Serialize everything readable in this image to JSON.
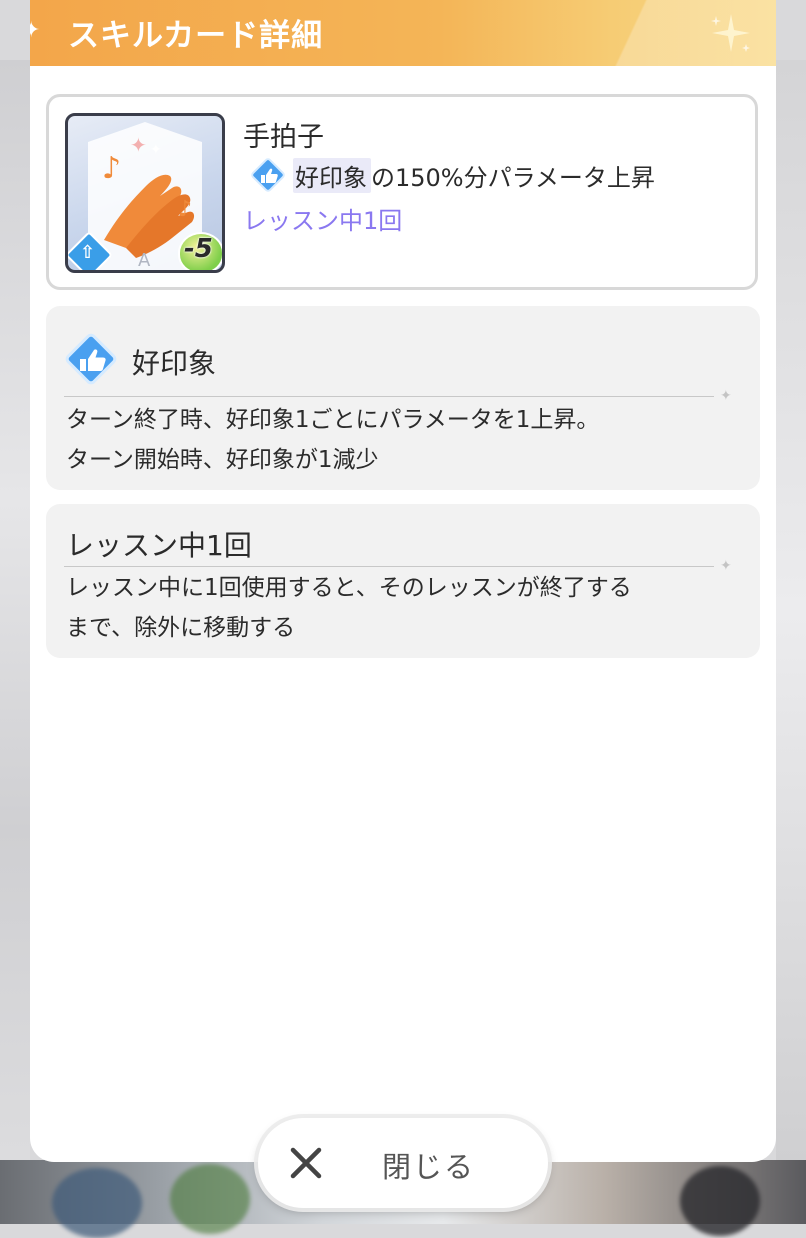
{
  "header": {
    "title": "スキルカード詳細"
  },
  "card": {
    "name": "手拍子",
    "effect_keyword": "好印象",
    "effect_text": "の150%分パラメータ上昇",
    "limit": "レッスン中1回",
    "cost": "-5",
    "rarity_letter": "A",
    "art_icon": "clapping-hands-icon",
    "cost_icon": "heart-icon",
    "plan_icon": "up-arrow-diamond-icon"
  },
  "keywords": [
    {
      "title": "好印象",
      "icon": "thumbs-up-icon",
      "lines": [
        "ターン終了時、好印象1ごとにパラメータを1上昇。",
        "ターン開始時、好印象が1減少"
      ]
    },
    {
      "title": "レッスン中1回",
      "lines": [
        "レッスン中に1回使用すると、そのレッスンが終了する",
        "まで、除外に移動する"
      ]
    }
  ],
  "close_button": {
    "label": "閉じる",
    "icon": "close-icon"
  },
  "colors": {
    "header_start": "#f3a64a",
    "header_end": "#f8d884",
    "limit_text": "#8a78f0",
    "thumb_icon": "#4aa0f0",
    "panel_bg": "#f2f2f2"
  }
}
